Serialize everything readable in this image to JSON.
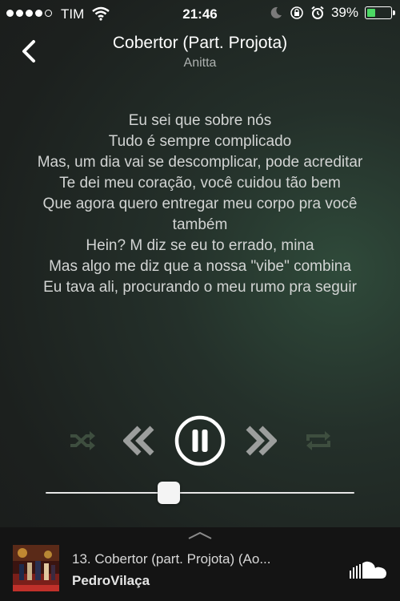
{
  "status": {
    "carrier": "TIM",
    "time": "21:46",
    "battery": "39%",
    "battery_level": 0.39,
    "signal_bars_filled": 4
  },
  "header": {
    "title": "Cobertor (Part. Projota)",
    "artist": "Anitta",
    "back_icon": "chevron-left-icon"
  },
  "lyrics": [
    "Eu sei que sobre nós",
    "Tudo é sempre complicado",
    "Mas, um dia vai se descomplicar, pode acreditar",
    "Te dei meu coração, você cuidou tão bem",
    "Que agora quero entregar meu corpo pra você também",
    "Hein? M diz se eu to errado, mina",
    "Mas algo me diz que a nossa \"vibe\" combina",
    "Eu tava ali, procurando o meu rumo pra seguir"
  ],
  "controls": {
    "shuffle_icon": "shuffle-icon",
    "rewind_icon": "rewind-icon",
    "pause_icon": "pause-icon",
    "forward_icon": "fast-forward-icon",
    "repeat_icon": "repeat-icon",
    "accent_inactive": "#3a4a3a"
  },
  "progress": {
    "fraction": 0.4
  },
  "mini_player": {
    "track": "13. Cobertor (part. Projota) (Ao...",
    "user": "PedroVilaça",
    "service_icon": "soundcloud-icon"
  }
}
